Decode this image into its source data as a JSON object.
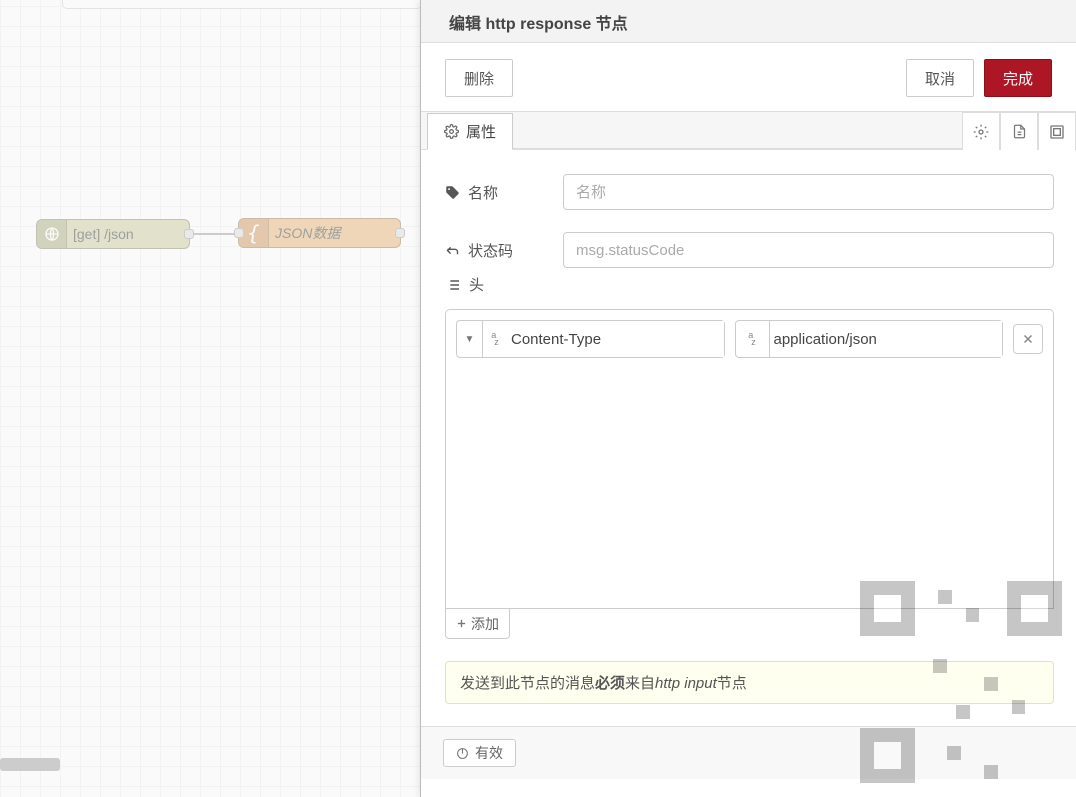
{
  "canvas": {
    "node_http_label": "[get] /json",
    "node_json_label": "JSON数据"
  },
  "panel": {
    "title": "编辑 http response 节点",
    "delete_label": "删除",
    "cancel_label": "取消",
    "done_label": "完成"
  },
  "tabs": {
    "properties_label": "属性"
  },
  "form": {
    "name_label": "名称",
    "name_placeholder": "名称",
    "status_label": "状态码",
    "status_placeholder": "msg.statusCode",
    "headers_label": "头"
  },
  "headers": {
    "rows": [
      {
        "key": "Content-Type",
        "value": "application/json"
      }
    ],
    "add_label": "添加"
  },
  "tip": {
    "pre": "发送到此节点的消息",
    "bold": "必须",
    "mid": "来自",
    "em": "http input",
    "post": "节点"
  },
  "footer": {
    "enabled_label": "有效"
  }
}
